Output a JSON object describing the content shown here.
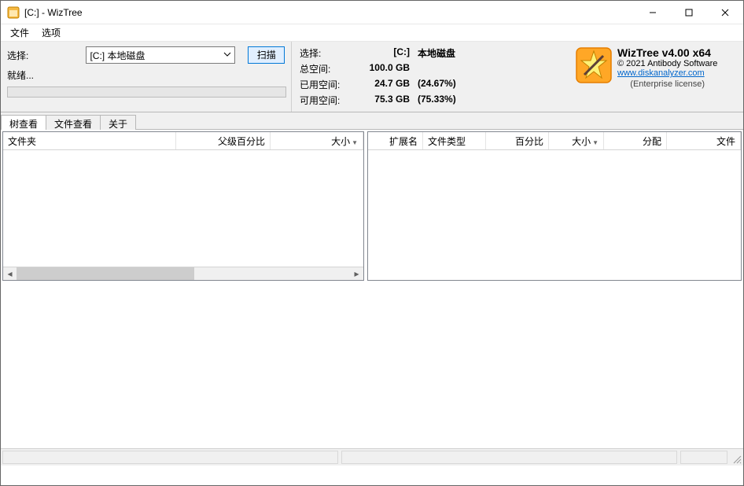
{
  "window": {
    "title": "[C:]  - WizTree"
  },
  "menu": {
    "file": "文件",
    "options": "选项"
  },
  "controls": {
    "select_label": "选择:",
    "drive_selected": "[C:] 本地磁盘",
    "scan_btn": "扫描",
    "ready_label": "就绪..."
  },
  "info": {
    "select_label": "选择:",
    "drive_code": "[C:]",
    "drive_name": "本地磁盘",
    "total_label": "总空间:",
    "total_val": "100.0 GB",
    "used_label": "已用空间:",
    "used_val": "24.7 GB",
    "used_pct": "(24.67%)",
    "free_label": "可用空间:",
    "free_val": "75.3 GB",
    "free_pct": "(75.33%)"
  },
  "brand": {
    "title": "WizTree v4.00 x64",
    "copyright": "© 2021 Antibody Software",
    "url": "www.diskanalyzer.com",
    "license": "(Enterprise license)"
  },
  "tabs": {
    "tree": "树查看",
    "file": "文件查看",
    "about": "关于"
  },
  "left_cols": {
    "folder": "文件夹",
    "parent_pct": "父级百分比",
    "size": "大小"
  },
  "right_cols": {
    "ext": "扩展名",
    "type": "文件类型",
    "pct": "百分比",
    "size": "大小",
    "alloc": "分配",
    "files": "文件"
  }
}
